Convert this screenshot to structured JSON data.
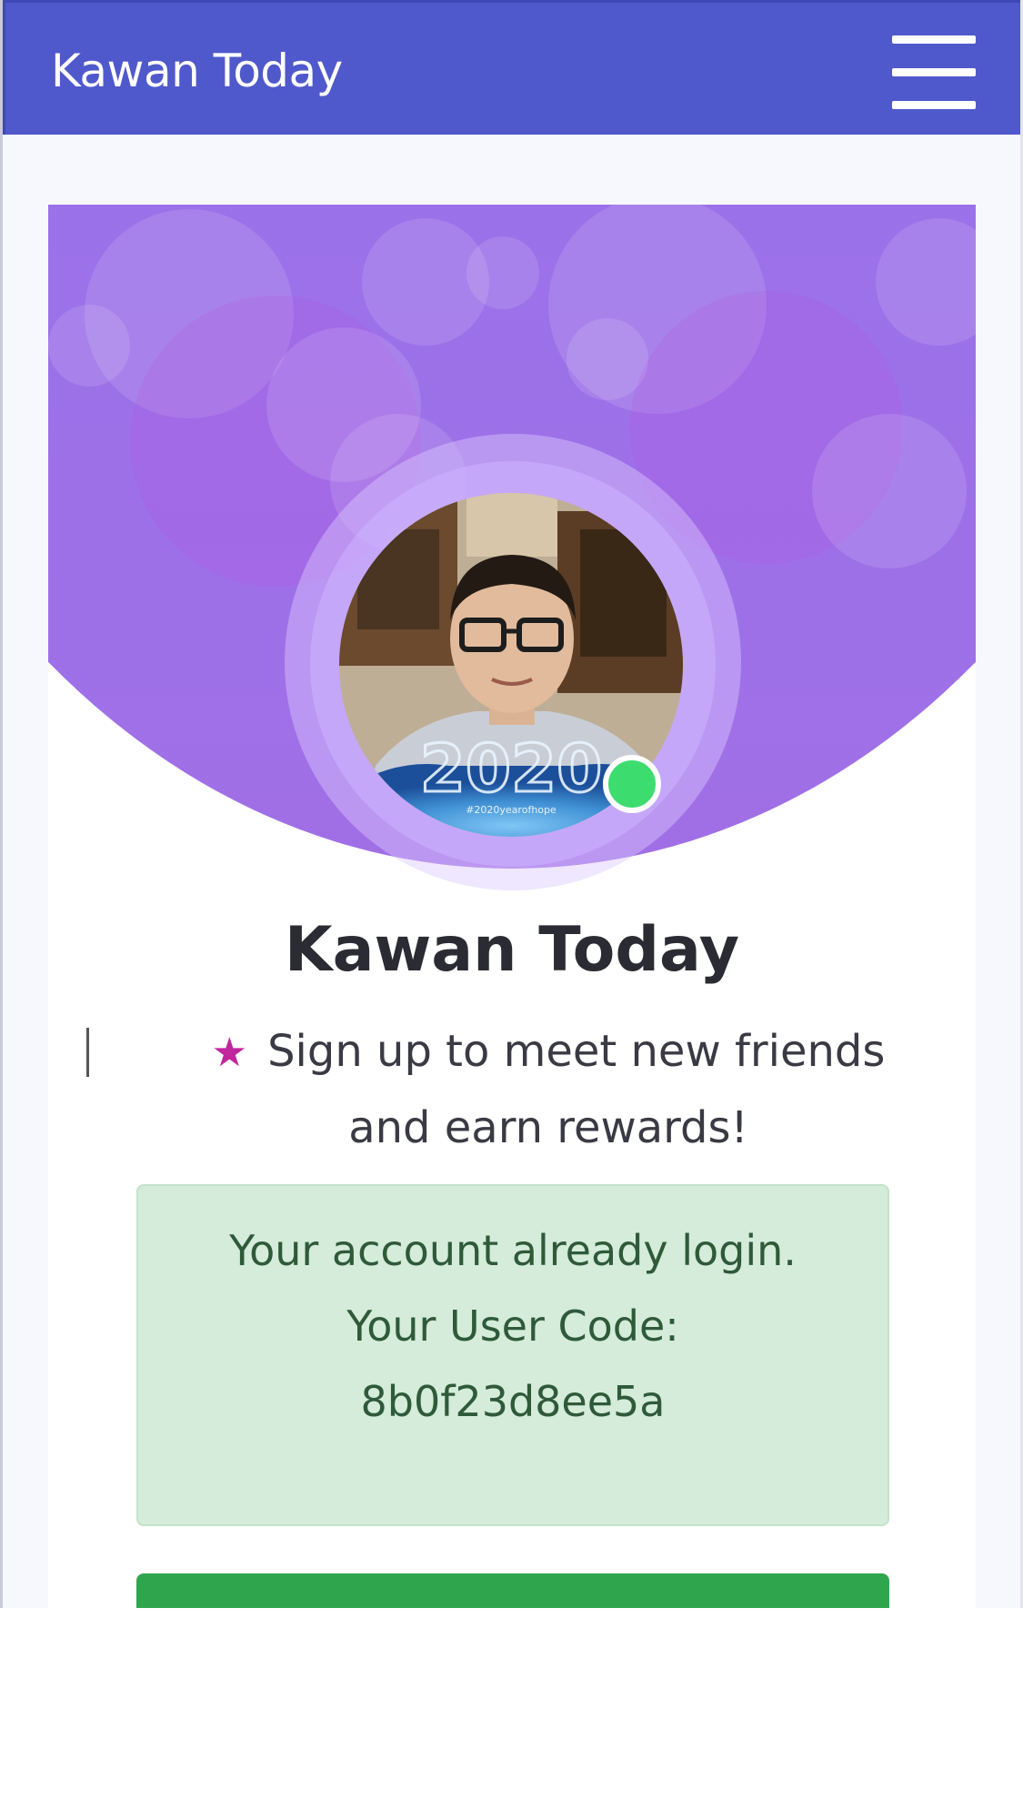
{
  "navbar": {
    "brand": "Kawan Today",
    "menu_icon": "hamburger-menu-icon"
  },
  "profile": {
    "name": "Kawan Today",
    "online_status_color": "#3ddc6f",
    "tagline_icon": "star-icon",
    "tagline": "Sign up to meet new friends and earn rewards!"
  },
  "alert": {
    "line1": "Your account already login.",
    "line2": "Your User Code:",
    "user_code": "8b0f23d8ee5a"
  },
  "colors": {
    "navbar": "#4f59cb",
    "hero": "#9274ee",
    "alert_bg": "#d4ecd9",
    "button": "#2fa54e",
    "star": "#c0279e"
  }
}
